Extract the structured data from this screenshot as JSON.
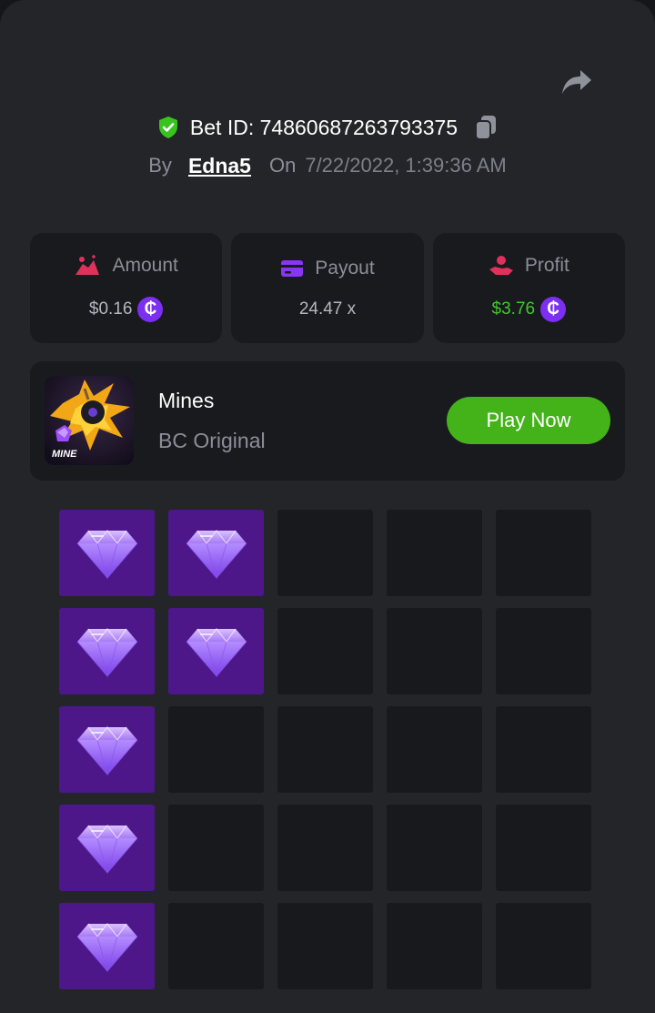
{
  "bet": {
    "label": "Bet ID: 74860687263793375",
    "by_label": "By",
    "username": "Edna5",
    "on_label": "On",
    "datetime": "7/22/2022, 1:39:36 AM"
  },
  "stats": {
    "amount": {
      "label": "Amount",
      "value": "$0.16",
      "currency_symbol": "₵"
    },
    "payout": {
      "label": "Payout",
      "value": "24.47 x"
    },
    "profit": {
      "label": "Profit",
      "value": "$3.76",
      "currency_symbol": "₵"
    }
  },
  "game": {
    "name": "Mines",
    "provider": "BC Original",
    "thumb_text": "MINE",
    "play_label": "Play Now"
  },
  "grid": {
    "rows": 5,
    "cols": 5,
    "tiles": [
      [
        "gem",
        "gem",
        "hidden",
        "hidden",
        "hidden"
      ],
      [
        "gem",
        "gem",
        "hidden",
        "hidden",
        "hidden"
      ],
      [
        "gem",
        "hidden",
        "hidden",
        "hidden",
        "hidden"
      ],
      [
        "gem",
        "hidden",
        "hidden",
        "hidden",
        "hidden"
      ],
      [
        "gem",
        "hidden",
        "hidden",
        "hidden",
        "hidden"
      ]
    ]
  },
  "colors": {
    "panel": "#232529",
    "card": "#191a1e",
    "accent_green": "#43b319",
    "profit_green": "#3fc92a",
    "gem_tile": "#4d178a",
    "coin": "#7b2ff0"
  }
}
